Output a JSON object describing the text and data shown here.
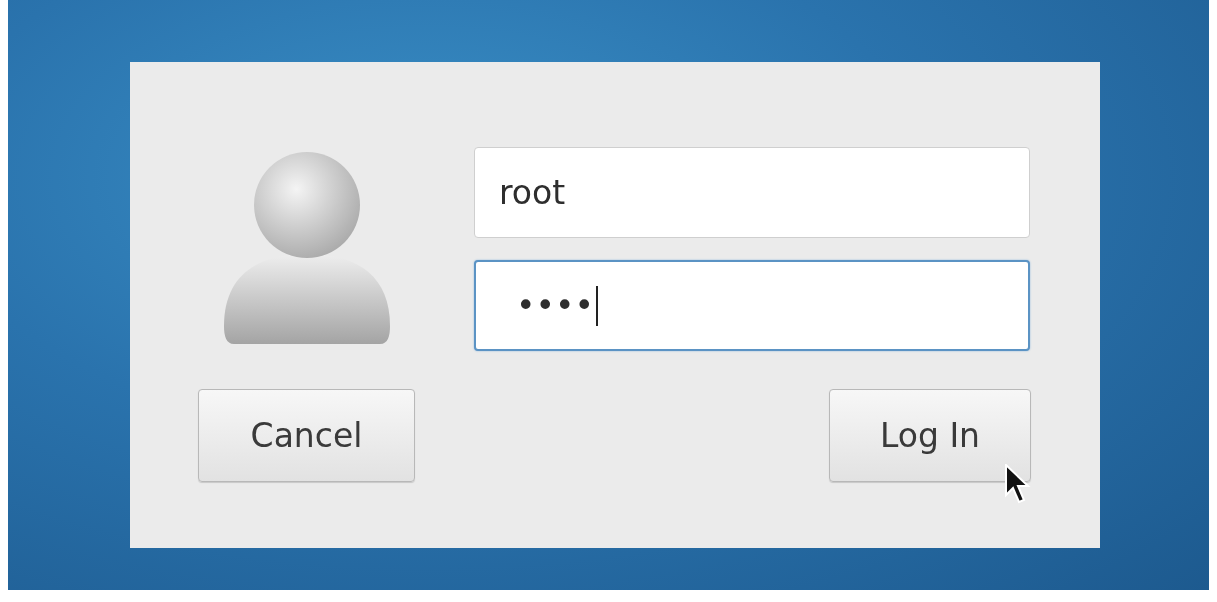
{
  "login_dialog": {
    "username": {
      "value": "root",
      "focused": false
    },
    "password": {
      "value": "••••",
      "focused": true
    },
    "buttons": [
      {
        "label": "Cancel",
        "kind": "cancel"
      },
      {
        "label": "Log In",
        "kind": "login"
      }
    ]
  }
}
